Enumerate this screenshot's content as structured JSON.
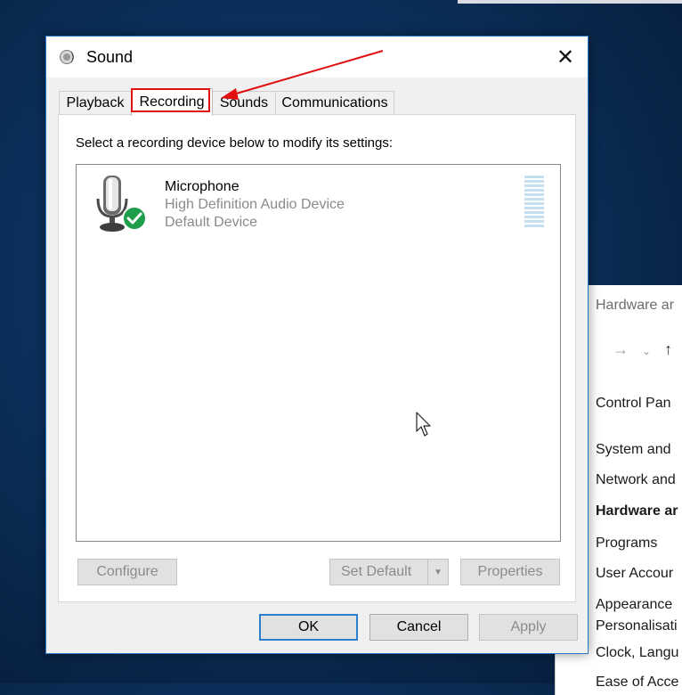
{
  "dialog": {
    "title": "Sound",
    "tabs": [
      {
        "label": "Playback",
        "active": false
      },
      {
        "label": "Recording",
        "active": true
      },
      {
        "label": "Sounds",
        "active": false
      },
      {
        "label": "Communications",
        "active": false
      }
    ],
    "instruction": "Select a recording device below to modify its settings:",
    "devices": [
      {
        "name": "Microphone",
        "description": "High Definition Audio Device",
        "status": "Default Device",
        "icon": "microphone-icon",
        "badge": "checkmark-icon"
      }
    ],
    "buttons": {
      "configure": "Configure",
      "set_default": "Set Default",
      "properties": "Properties",
      "ok": "OK",
      "cancel": "Cancel",
      "apply": "Apply"
    }
  },
  "background_window": {
    "title": "Hardware ar",
    "crumb": "Control Pan",
    "categories": [
      {
        "label": "System and",
        "bold": false
      },
      {
        "label": "Network and",
        "bold": false
      },
      {
        "label": "Hardware ar",
        "bold": true
      },
      {
        "label": "Programs",
        "bold": false
      },
      {
        "label": "User Accour",
        "bold": false
      },
      {
        "label": "Appearance",
        "bold": false
      },
      {
        "label": "Personalisati",
        "bold": false
      },
      {
        "label": "Clock, Langu",
        "bold": false
      },
      {
        "label": "Ease of Acce",
        "bold": false
      }
    ]
  },
  "colors": {
    "annotation": "#e01010",
    "accent": "#2f7fd0",
    "status_badge": "#1e9e4a"
  }
}
